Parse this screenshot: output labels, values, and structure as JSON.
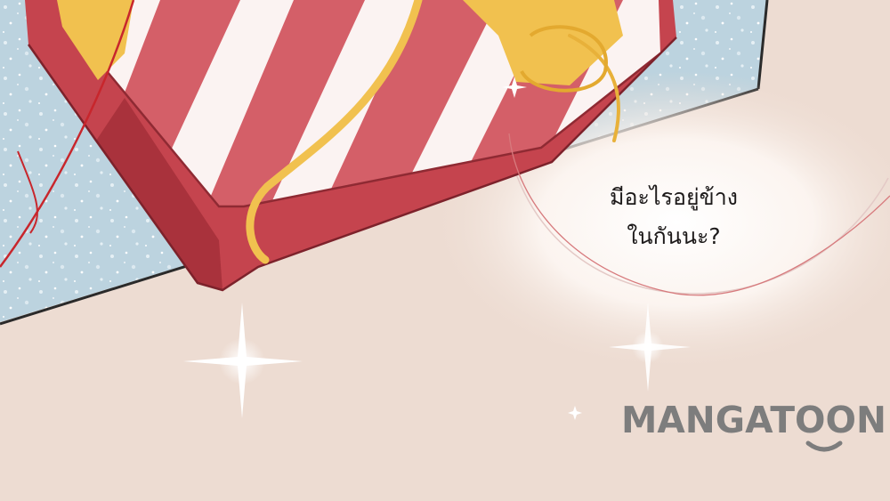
{
  "speech_bubble": {
    "line_1": "มีอะไรอยู่ข้าง",
    "line_2": "ในกันนะ?"
  },
  "watermark": {
    "text": "MANGATOON"
  },
  "colors": {
    "background": "#eddcd2",
    "snow_panel": "#bcd3df",
    "box_red": "#cf5a63",
    "stripe_white": "#fbf3f2",
    "ribbon_gold": "#f1c14f",
    "string_red": "#c8262c",
    "watermark_grey": "#7d7d7d"
  }
}
